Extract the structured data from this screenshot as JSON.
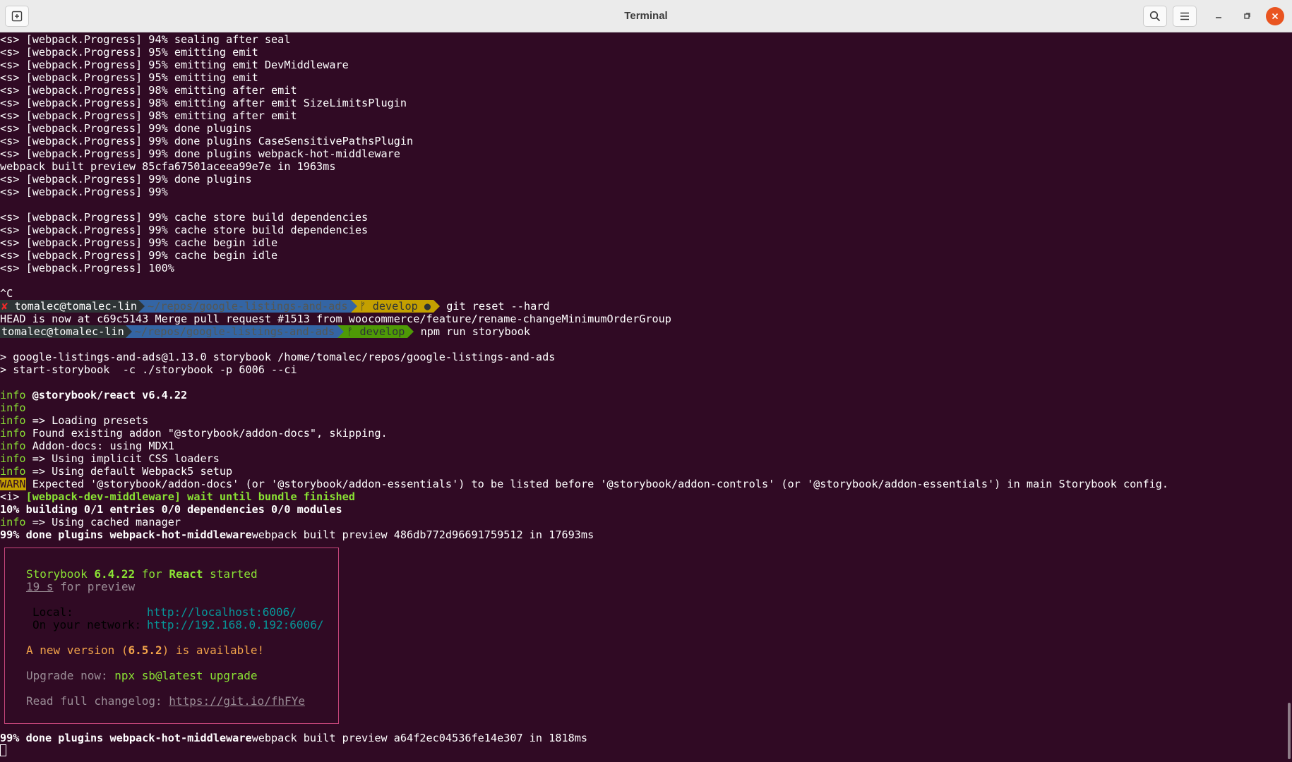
{
  "window": {
    "title": "Terminal",
    "icons": [
      "new-tab-icon",
      "search-icon",
      "hamburger-menu-icon",
      "minimize-icon",
      "maximize-icon",
      "close-icon"
    ]
  },
  "colors": {
    "background": "#300a24",
    "info": "#8ae234",
    "warn_bg": "#c4a000",
    "box_border": "#c6467b",
    "link": "#06989a"
  },
  "log": [
    "<s> [webpack.Progress] 94% sealing after seal",
    "<s> [webpack.Progress] 95% emitting emit",
    "<s> [webpack.Progress] 95% emitting emit DevMiddleware",
    "<s> [webpack.Progress] 95% emitting emit",
    "<s> [webpack.Progress] 98% emitting after emit",
    "<s> [webpack.Progress] 98% emitting after emit SizeLimitsPlugin",
    "<s> [webpack.Progress] 98% emitting after emit",
    "<s> [webpack.Progress] 99% done plugins",
    "<s> [webpack.Progress] 99% done plugins CaseSensitivePathsPlugin",
    "<s> [webpack.Progress] 99% done plugins webpack-hot-middleware",
    "webpack built preview 85cfa67501aceea99e7e in 1963ms",
    "<s> [webpack.Progress] 99% done plugins",
    "<s> [webpack.Progress] 99%",
    "",
    "<s> [webpack.Progress] 99% cache store build dependencies",
    "<s> [webpack.Progress] 99% cache store build dependencies",
    "<s> [webpack.Progress] 99% cache begin idle",
    "<s> [webpack.Progress] 99% cache begin idle",
    "<s> [webpack.Progress] 100%",
    "",
    "^C"
  ],
  "prompt1": {
    "error_mark": "✘",
    "user": "tomalec@tomalec-lin",
    "path": "~/repos/google-listings-and-ads",
    "branch": "ᚠ develop ●",
    "command": "git reset --hard"
  },
  "head_line": "HEAD is now at c69c5143 Merge pull request #1513 from woocommerce/feature/rename-changeMinimumOrderGroup",
  "prompt2": {
    "user": "tomalec@tomalec-lin",
    "path": "~/repos/google-listings-and-ads",
    "branch": "ᚠ develop",
    "command": "npm run storybook"
  },
  "npm_lines": [
    "> google-listings-and-ads@1.13.0 storybook /home/tomalec/repos/google-listings-and-ads",
    "> start-storybook  -c ./storybook -p 6006 --ci"
  ],
  "info_lines": [
    {
      "tag": "info",
      "text": "@storybook/react v6.4.22",
      "bold": true
    },
    {
      "tag": "info",
      "text": "",
      "bold": false
    },
    {
      "tag": "info",
      "text": "=> Loading presets",
      "bold": false
    },
    {
      "tag": "info",
      "text": "Found existing addon \"@storybook/addon-docs\", skipping.",
      "bold": false
    },
    {
      "tag": "info",
      "text": "Addon-docs: using MDX1",
      "bold": false
    },
    {
      "tag": "info",
      "text": "=> Using implicit CSS loaders",
      "bold": false
    },
    {
      "tag": "info",
      "text": "=> Using default Webpack5 setup",
      "bold": false
    }
  ],
  "warn": {
    "tag": "WARN",
    "text": "Expected '@storybook/addon-docs' (or '@storybook/addon-essentials') to be listed before '@storybook/addon-controls' (or '@storybook/addon-essentials') in main Storybook config."
  },
  "wdm": {
    "prefix": "<i>",
    "text": "[webpack-dev-middleware] wait until bundle finished"
  },
  "building": "10% building 0/1 entries 0/0 dependencies 0/0 modules",
  "cached": {
    "tag": "info",
    "text": "=> Using cached manager"
  },
  "built1": {
    "bold": "99% done plugins webpack-hot-middleware",
    "rest": "webpack built preview 486db772d96691759512 in 17693ms"
  },
  "box": {
    "sb_name": "Storybook",
    "sb_version": "6.4.22",
    "for": "for",
    "framework": "React",
    "started": "started",
    "time": "19 s",
    "for_preview": "for preview",
    "local_label": "Local:",
    "local_url": "http://localhost:6006/",
    "network_label": "On your network:",
    "network_url": "http://192.168.0.192:6006/",
    "new_version_pre": "A new version (",
    "new_version": "6.5.2",
    "new_version_post": ") is available!",
    "upgrade_label": "Upgrade now:",
    "upgrade_cmd": "npx sb@latest upgrade",
    "changelog_label": "Read full changelog:",
    "changelog_url": "https://git.io/fhFYe"
  },
  "built2": {
    "bold": "99% done plugins webpack-hot-middleware",
    "rest": "webpack built preview a64f2ec04536fe14e307 in 1818ms"
  }
}
